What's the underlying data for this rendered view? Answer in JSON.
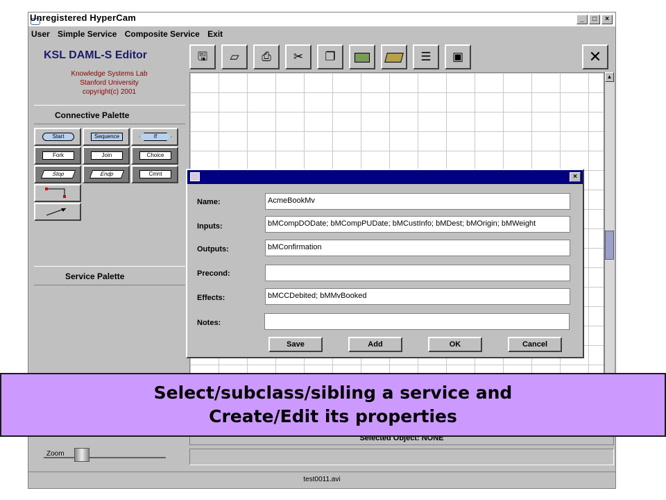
{
  "window": {
    "title": "Unregistered HyperCam",
    "buttons": {
      "minimize": "_",
      "maximize": "□",
      "close": "×"
    }
  },
  "menu": [
    "User",
    "Simple Service",
    "Composite Service",
    "Exit"
  ],
  "logo": {
    "title": "KSL DAML-S Editor",
    "lines": [
      "Knowledge Systems Lab",
      "Stanford University",
      "copyright(c) 2001"
    ]
  },
  "connective_palette": {
    "title": "Connective Palette",
    "buttons": [
      "Start",
      "Sequence",
      "If",
      "Fork",
      "Join",
      "Choice",
      "Stop",
      "Endp",
      "Cmnt"
    ]
  },
  "service_palette": {
    "title": "Service Palette"
  },
  "toolbar_icons": [
    "save-icon",
    "print-preview-icon",
    "printer-icon",
    "cut-icon",
    "paste-icon",
    "rectangle-icon",
    "open-folder-icon",
    "list-icon",
    "frame-icon",
    "close-icon"
  ],
  "dialog": {
    "labels": {
      "name": "Name:",
      "inputs": "Inputs:",
      "outputs": "Outputs:",
      "precond": "Precond:",
      "effects": "Effects:",
      "notes": "Notes:"
    },
    "values": {
      "name": "AcmeBookMv",
      "inputs": "bMCompDODate; bMCompPUDate; bMCustInfo; bMDest; bMOrigin; bMWeight",
      "outputs": "bMConfirmation",
      "precond": "",
      "effects": "bMCCDebited; bMMvBooked",
      "notes": ""
    },
    "buttons": {
      "save": "Save",
      "add": "Add",
      "ok": "OK",
      "cancel": "Cancel"
    }
  },
  "status": {
    "selected": "Selected Object:  NONE"
  },
  "zoom": {
    "label": "Zoom"
  },
  "footer": {
    "filename": "test0011.avi"
  },
  "caption": {
    "line1": "Select/subclass/sibling a service and",
    "line2": "Create/Edit its properties"
  }
}
